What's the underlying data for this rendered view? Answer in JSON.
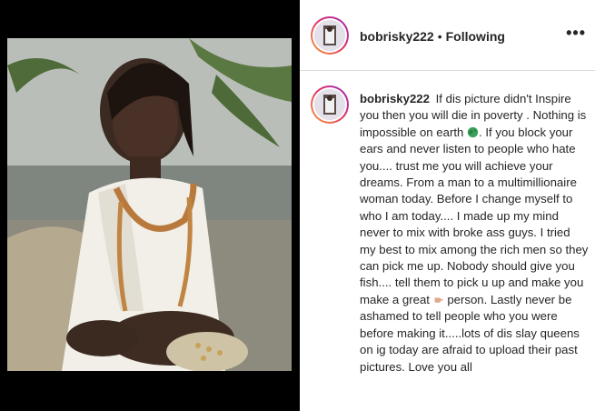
{
  "post": {
    "username": "bobrisky222",
    "separator": "•",
    "follow_status": "Following",
    "more_glyph": "•••"
  },
  "caption": {
    "username": "bobrisky222",
    "part1": "If dis picture didn't Inspire you then you will die in poverty . Nothing is impossible on earth",
    "part2": ". If you block your ears and never listen to people who hate you.... trust me you will achieve your dreams. From a man to a multimillionaire woman today. Before I change myself to who I am today.... I made up my mind never to mix with broke ass guys. I tried my best to mix among the rich men so they can pick me up. Nobody should give you fish.... tell them to pick u up and make you make a great",
    "part3": "person. Lastly never be ashamed to tell people who you were before making it.....lots of dis slay queens on ig today are afraid to upload their past pictures. Love you all",
    "emoji1": "earth-globe-emoji",
    "emoji2": "pointing-hand-emoji"
  },
  "colors": {
    "text": "#262626",
    "divider": "#dbdbdb",
    "story_ring_start": "#f9a43a",
    "story_ring_end": "#9a31c4"
  }
}
